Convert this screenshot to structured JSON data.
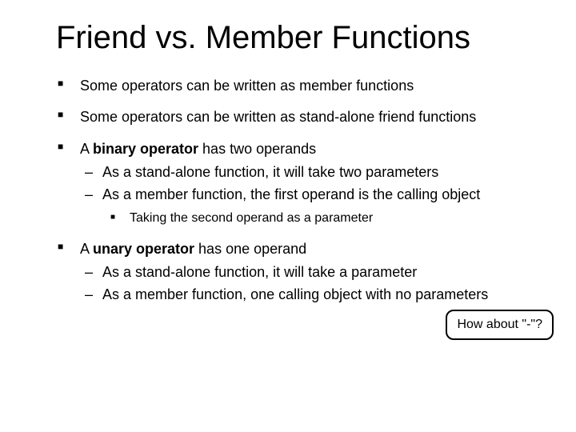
{
  "title": "Friend vs. Member Functions",
  "bullets": {
    "b1": "Some operators can be written as member functions",
    "b2": "Some operators can be written as stand-alone friend functions",
    "b3_pre": "A ",
    "b3_bold": "binary operator",
    "b3_post": " has two operands",
    "b3_sub1": "As a stand-alone function, it will take two parameters",
    "b3_sub2": "As a member function, the first operand is the calling object",
    "b3_sub2_sub1": "Taking the second operand as a parameter",
    "b4_pre": "A ",
    "b4_bold": "unary operator",
    "b4_post": " has one operand",
    "b4_sub1": "As a stand-alone function, it will take a parameter",
    "b4_sub2": "As a member function, one calling object with no parameters"
  },
  "callout": "How about \"-\"?"
}
